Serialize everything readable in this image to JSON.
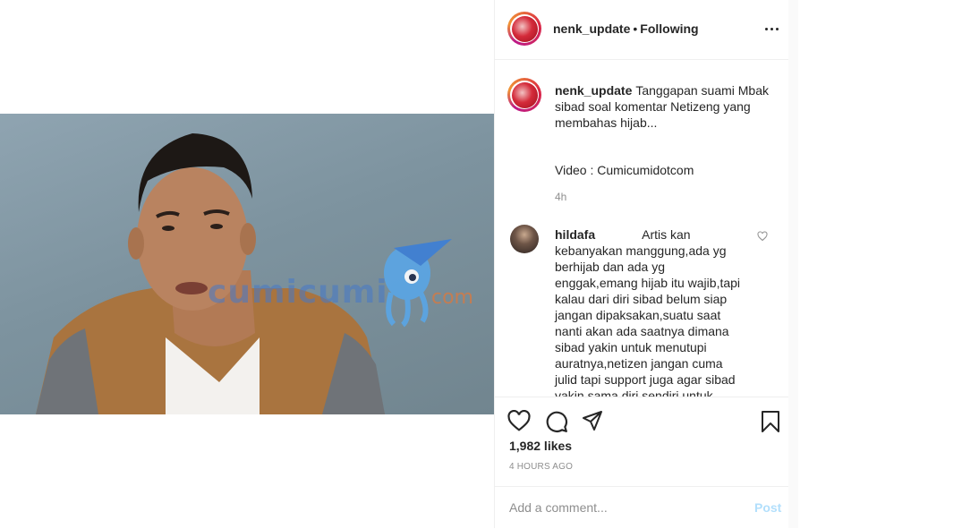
{
  "post": {
    "username": "nenk_update",
    "follow_status": "Following",
    "separator": "•",
    "more_icon": "more-horizontal-icon"
  },
  "media": {
    "watermark": "cumicumi",
    "watermark_suffix": "com"
  },
  "caption": {
    "username": "nenk_update",
    "text": "Tanggapan suami Mbak sibad soal komentar Netizeng yang membahas hijab...",
    "credit": "Video : Cumicumidotcom",
    "time": "4h"
  },
  "comments": [
    {
      "username": "hildafa",
      "text": "Artis kan kebanyakan manggung,ada yg berhijab dan ada yg enggak,emang hijab itu wajib,tapi kalau dari diri sibad belum siap jangan dipaksakan,suatu saat nanti akan ada saatnya dimana sibad yakin untuk menutupi auratnya,netizen jangan cuma julid tapi support juga agar sibad yakin sama diri sendiri untuk"
    }
  ],
  "actions": {
    "like_icon": "heart-icon",
    "comment_icon": "comment-icon",
    "share_icon": "paper-plane-icon",
    "save_icon": "bookmark-icon",
    "likes": "1,982 likes",
    "timestamp": "4 HOURS AGO"
  },
  "add_comment": {
    "placeholder": "Add a comment...",
    "post_label": "Post"
  },
  "colors": {
    "text": "#262626",
    "secondary": "#8e8e8e",
    "post_disabled": "#b2dffc",
    "border": "#efefef"
  }
}
